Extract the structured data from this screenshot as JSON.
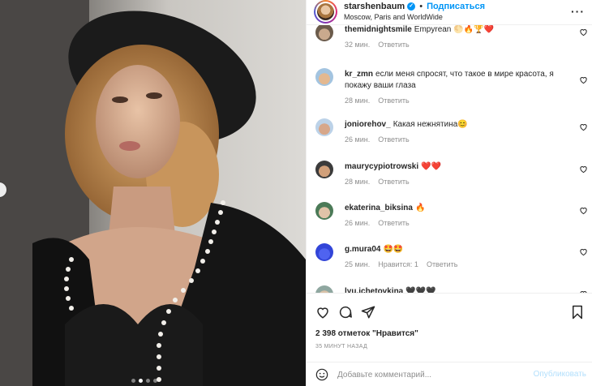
{
  "header": {
    "username": "starshenbaum",
    "separator": "•",
    "follow_label": "Подписаться",
    "location": "Moscow, Paris and WorldWide",
    "more_icon": "more-icon"
  },
  "comments": [
    {
      "user": "themidnightsmile",
      "text": "Empyrean 🌕🔥🏆❤️",
      "time": "32 мин.",
      "reply": "Ответить",
      "likes": ""
    },
    {
      "user": "kr_zmn",
      "text": "если меня спросят, что такое в мире красота, я покажу ваши глаза",
      "time": "28 мин.",
      "reply": "Ответить",
      "likes": ""
    },
    {
      "user": "joniorehov_",
      "text": "Какая нежнятина😊",
      "time": "26 мин.",
      "reply": "Ответить",
      "likes": ""
    },
    {
      "user": "maurycypiotrowski",
      "text": "❤️❤️",
      "time": "28 мин.",
      "reply": "Ответить",
      "likes": ""
    },
    {
      "user": "ekaterina_biksina",
      "text": "🔥",
      "time": "26 мин.",
      "reply": "Ответить",
      "likes": ""
    },
    {
      "user": "g.mura04",
      "text": "🤩🤩",
      "time": "25 мин.",
      "reply": "Ответить",
      "likes": "Нравится: 1"
    },
    {
      "user": "lyu.ichetovkina",
      "text": "🖤🖤🖤",
      "time": "",
      "reply": "",
      "likes": ""
    }
  ],
  "actions": {
    "like_icon": "heart-icon",
    "comment_icon": "comment-icon",
    "share_icon": "share-icon",
    "save_icon": "bookmark-icon",
    "likes_text": "2 398 отметок \"Нравится\"",
    "posted_time": "35 МИНУТ НАЗАД"
  },
  "add_comment": {
    "emoji_icon": "emoji-icon",
    "placeholder": "Добавьте комментарий...",
    "publish_label": "Опубликовать"
  },
  "carousel": {
    "total": 4,
    "active": 1
  },
  "colors": {
    "accent": "#0095f6",
    "publish_disabled": "#b2dffc",
    "muted": "#8e8e8e"
  }
}
